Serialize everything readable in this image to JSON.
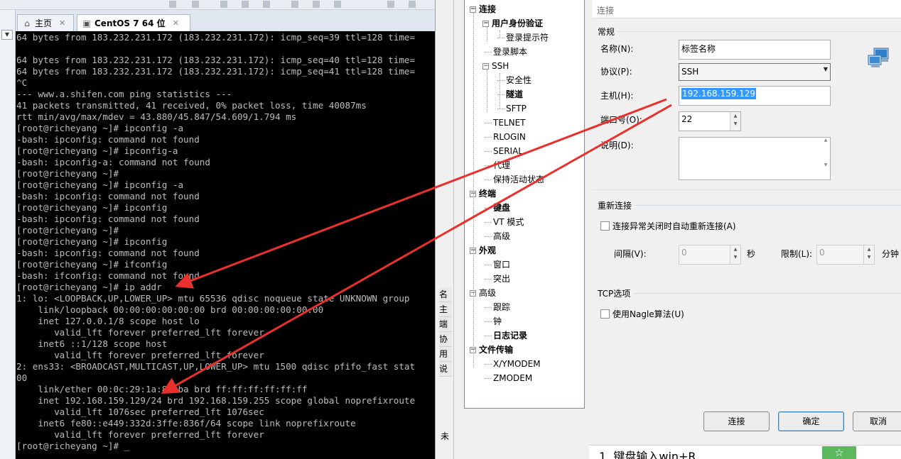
{
  "vmware": {
    "tabs": [
      {
        "label": "主页",
        "icon": "home-icon"
      },
      {
        "label": "CentOS 7 64 位",
        "icon": "vm-icon"
      }
    ],
    "close_glyph": "✕"
  },
  "terminal": {
    "lines": [
      "64 bytes from 183.232.231.172 (183.232.231.172): icmp_seq=39 ttl=128 time=",
      "",
      "64 bytes from 183.232.231.172 (183.232.231.172): icmp_seq=40 ttl=128 time=",
      "64 bytes from 183.232.231.172 (183.232.231.172): icmp_seq=41 ttl=128 time=",
      "^C",
      "--- www.a.shifen.com ping statistics ---",
      "41 packets transmitted, 41 received, 0% packet loss, time 40087ms",
      "rtt min/avg/max/mdev = 43.880/45.847/54.609/1.794 ms",
      "[root@richeyang ~]# ipconfig -a",
      "-bash: ipconfig: command not found",
      "[root@richeyang ~]# ipconfig-a",
      "-bash: ipconfig-a: command not found",
      "[root@richeyang ~]#",
      "[root@richeyang ~]# ipconfig -a",
      "-bash: ipconfig: command not found",
      "[root@richeyang ~]# ipconfig",
      "-bash: ipconfig: command not found",
      "[root@richeyang ~]#",
      "[root@richeyang ~]# ipconfig",
      "-bash: ipconfig: command not found",
      "[root@richeyang ~]# ifconfig",
      "-bash: ifconfig: command not found",
      "[root@richeyang ~]# ip addr",
      "1: lo: <LOOPBACK,UP,LOWER_UP> mtu 65536 qdisc noqueue state UNKNOWN group",
      "    link/loopback 00:00:00:00:00:00 brd 00:00:00:00:00:00",
      "    inet 127.0.0.1/8 scope host lo",
      "       valid_lft forever preferred_lft forever",
      "    inet6 ::1/128 scope host",
      "       valid_lft forever preferred_lft forever",
      "2: ens33: <BROADCAST,MULTICAST,UP,LOWER_UP> mtu 1500 qdisc pfifo_fast stat",
      "00",
      "    link/ether 00:0c:29:1a:8c:ba brd ff:ff:ff:ff:ff:ff",
      "    inet 192.168.159.129/24 brd 192.168.159.255 scope global noprefixroute",
      "       valid_lft 1076sec preferred_lft 1076sec",
      "    inet6 fe80::e449:332d:3ffe:836f/64 scope link noprefixroute",
      "       valid_lft forever preferred_lft forever",
      "[root@richeyang ~]# _"
    ]
  },
  "behind_window": {
    "labels": [
      "名",
      "主",
      "端",
      "协",
      "用",
      "说"
    ],
    "bottom_label": "未"
  },
  "tree": {
    "items": [
      {
        "label": "连接",
        "bold": true,
        "expander": "−"
      },
      {
        "label": "用户身份验证",
        "bold": true,
        "expander": "−"
      },
      {
        "label": "登录提示符",
        "bold": false
      },
      {
        "label": "登录脚本",
        "bold": false
      },
      {
        "label": "SSH",
        "bold": false,
        "expander": "−"
      },
      {
        "label": "安全性",
        "bold": false
      },
      {
        "label": "隧道",
        "bold": true
      },
      {
        "label": "SFTP",
        "bold": false
      },
      {
        "label": "TELNET",
        "bold": false
      },
      {
        "label": "RLOGIN",
        "bold": false
      },
      {
        "label": "SERIAL",
        "bold": false
      },
      {
        "label": "代理",
        "bold": false
      },
      {
        "label": "保持活动状态",
        "bold": false
      },
      {
        "label": "终端",
        "bold": true,
        "expander": "−"
      },
      {
        "label": "键盘",
        "bold": true
      },
      {
        "label": "VT 模式",
        "bold": false
      },
      {
        "label": "高级",
        "bold": false
      },
      {
        "label": "外观",
        "bold": true,
        "expander": "−"
      },
      {
        "label": "窗口",
        "bold": false
      },
      {
        "label": "突出",
        "bold": false
      },
      {
        "label": "高级",
        "bold": false,
        "expander": "−"
      },
      {
        "label": "跟踪",
        "bold": false
      },
      {
        "label": "钟",
        "bold": false
      },
      {
        "label": "日志记录",
        "bold": true
      },
      {
        "label": "文件传输",
        "bold": true,
        "expander": "−"
      },
      {
        "label": "X/YMODEM",
        "bold": false
      },
      {
        "label": "ZMODEM",
        "bold": false
      }
    ]
  },
  "panel": {
    "title": "连接",
    "general_group": "常规",
    "name_label": "名称(N):",
    "name_value": "标签名称",
    "protocol_label": "协议(P):",
    "protocol_value": "SSH",
    "host_label": "主机(H):",
    "host_value": "192.168.159.129",
    "port_label": "端口号(O):",
    "port_value": "22",
    "desc_label": "说明(D):",
    "reconnect_group": "重新连接",
    "reconnect_check": "连接异常关闭时自动重新连接(A)",
    "interval_label": "间隔(V):",
    "interval_value": "0",
    "interval_unit": "秒",
    "limit_label": "限制(L):",
    "limit_value": "0",
    "limit_unit": "分钟",
    "tcp_group": "TCP选项",
    "nagle_check": "使用Nagle算法(U)"
  },
  "buttons": {
    "connect": "连接",
    "ok": "确定",
    "cancel": "取消"
  },
  "bottom": {
    "text": "1. 键盘输入win+R",
    "badge": "☆"
  },
  "colors": {
    "terminal_bg": "#000000",
    "terminal_fg": "#bdbdbd",
    "selection": "#3399ff",
    "annotation_arrow": "#e8302c"
  }
}
